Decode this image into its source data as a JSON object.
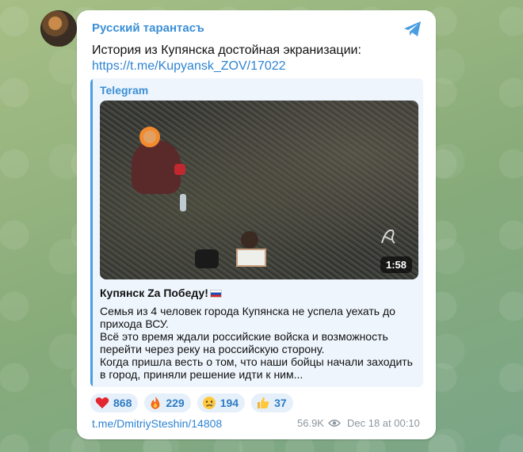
{
  "channel": {
    "name": "Русский тарантасъ"
  },
  "post": {
    "text": "История из Купянска достойная экранизации:",
    "link": "https://t.me/Kupyansk_ZOV/17022"
  },
  "preview": {
    "source": "Telegram",
    "duration": "1:58",
    "title": "Купянск Za Победу!",
    "description_lines": [
      "Семья из 4 человек города Купянска не успела уехать до",
      "прихода ВСУ.",
      "Всё это время ждали российские войска и возможность",
      "перейти через реку на российскую сторону.",
      "Когда пришла весть о том, что наши бойцы начали заходить",
      "в город, приняли решение идти к ним..."
    ]
  },
  "reactions": [
    {
      "icon": "heart-icon",
      "count": "868"
    },
    {
      "icon": "fire-icon",
      "count": "229"
    },
    {
      "icon": "crying-face-icon",
      "count": "194"
    },
    {
      "icon": "thumbs-up-icon",
      "count": "37"
    }
  ],
  "footer": {
    "link": "t.me/DmitriySteshin/14808",
    "views": "56.9K",
    "date": "Dec 18 at 00:10"
  },
  "colors": {
    "accent": "#3a8fd6",
    "link": "#2d84d3",
    "preview_bg": "#eef5fc",
    "reaction_bg": "#e6f0fa"
  }
}
